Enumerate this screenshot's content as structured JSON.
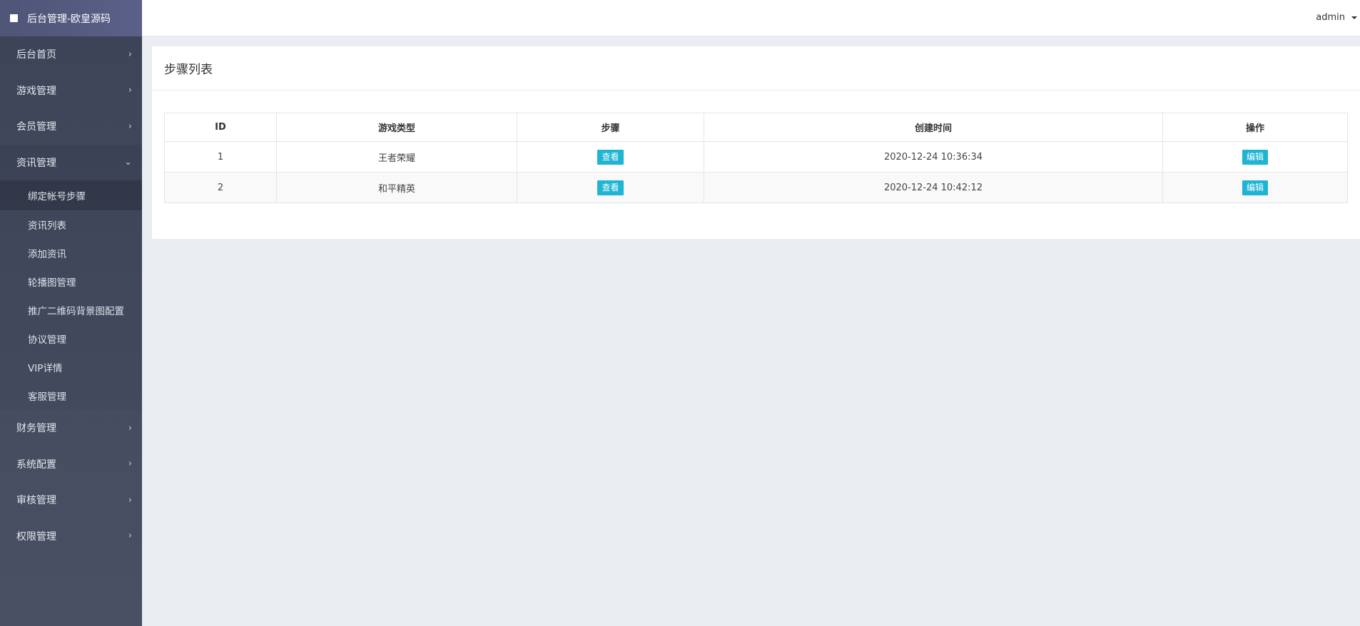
{
  "brand": {
    "title": "后台管理-欧皇源码"
  },
  "user": {
    "name": "admin"
  },
  "nav": {
    "items_top": [
      {
        "label": "后台首页"
      },
      {
        "label": "游戏管理"
      },
      {
        "label": "会员管理"
      }
    ],
    "open_group": {
      "label": "资讯管理",
      "children": [
        {
          "label": "绑定帐号步骤"
        },
        {
          "label": "资讯列表"
        },
        {
          "label": "添加资讯"
        },
        {
          "label": "轮播图管理"
        },
        {
          "label": "推广二维码背景图配置"
        },
        {
          "label": "协议管理"
        },
        {
          "label": "VIP详情"
        },
        {
          "label": "客服管理"
        }
      ]
    },
    "items_bottom": [
      {
        "label": "财务管理"
      },
      {
        "label": "系统配置"
      },
      {
        "label": "审核管理"
      },
      {
        "label": "权限管理"
      }
    ],
    "chevron_right": "›",
    "chevron_down": "⌄"
  },
  "page": {
    "title": "步骤列表"
  },
  "table": {
    "headers": [
      "ID",
      "游戏类型",
      "步骤",
      "创建时间",
      "操作"
    ],
    "rows": [
      {
        "id": "1",
        "game": "王者荣耀",
        "view_label": "查看",
        "created": "2020-12-24 10:36:34",
        "edit_label": "编辑"
      },
      {
        "id": "2",
        "game": "和平精英",
        "view_label": "查看",
        "created": "2020-12-24 10:42:12",
        "edit_label": "编辑"
      }
    ]
  },
  "colors": {
    "accent": "#1fb5d2",
    "sidebar": "#434a5e",
    "brand_bar": "#555c80"
  }
}
